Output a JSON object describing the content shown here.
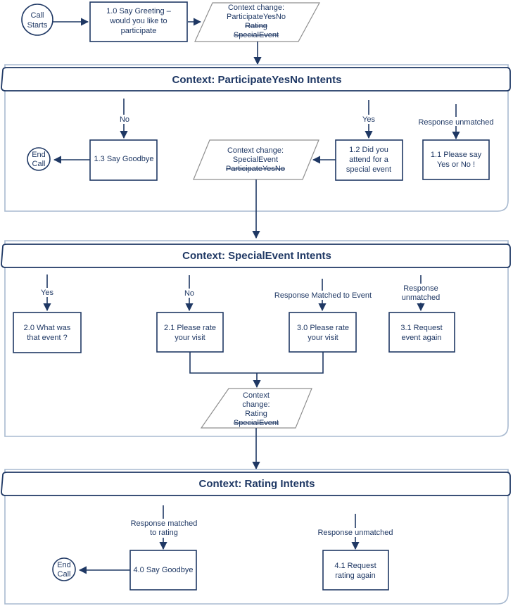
{
  "colors": {
    "ink": "#1f3864",
    "container_border": "#a9bad0",
    "decision_border": "#8f8f8f",
    "background": "#ffffff"
  },
  "start": {
    "call_starts": [
      "Call",
      "Starts"
    ],
    "step_1_0": [
      "1.0 Say Greeting –",
      "would you like to",
      "participate"
    ],
    "context_change_1": {
      "lines": [
        "Context change:",
        "ParticipateYesNo"
      ],
      "struck": [
        "Rating",
        "SpecialEvent"
      ]
    }
  },
  "sections": [
    {
      "title": "Context: ParticipateYesNo Intents",
      "edge_labels": {
        "no": "No",
        "yes": "Yes",
        "unmatched": "Response unmatched"
      },
      "nodes": {
        "end_call": [
          "End",
          "Call"
        ],
        "step_1_3": [
          "1.3 Say Goodbye"
        ],
        "context_change": {
          "lines": [
            "Context change:",
            "SpecialEvent"
          ],
          "struck": [
            "ParticipateYesNo"
          ]
        },
        "step_1_2": [
          "1.2 Did you",
          "attend for a",
          "special event"
        ],
        "step_1_1": [
          "1.1  Please say",
          "Yes or No !"
        ]
      }
    },
    {
      "title": "Context: SpecialEvent Intents",
      "edge_labels": {
        "yes": "Yes",
        "no": "No",
        "matched": "Response Matched to Event",
        "unmatched": [
          "Response",
          "unmatched"
        ]
      },
      "nodes": {
        "step_2_0": [
          "2.0 What was",
          "that event ?"
        ],
        "step_2_1": [
          "2.1 Please rate",
          "your visit"
        ],
        "step_3_0": [
          "3.0 Please rate",
          "your visit"
        ],
        "step_3_1": [
          "3.1 Request",
          "event again"
        ],
        "context_change": {
          "lines": [
            "Context",
            "change:",
            "Rating"
          ],
          "struck": [
            "SpecialEvent"
          ]
        }
      }
    },
    {
      "title": "Context: Rating Intents",
      "edge_labels": {
        "matched": [
          "Response matched",
          "to rating"
        ],
        "unmatched": "Response unmatched"
      },
      "nodes": {
        "end_call": [
          "End",
          "Call"
        ],
        "step_4_0": [
          "4.0 Say Goodbye"
        ],
        "step_4_1": [
          "4.1 Request",
          "rating again"
        ]
      }
    }
  ]
}
